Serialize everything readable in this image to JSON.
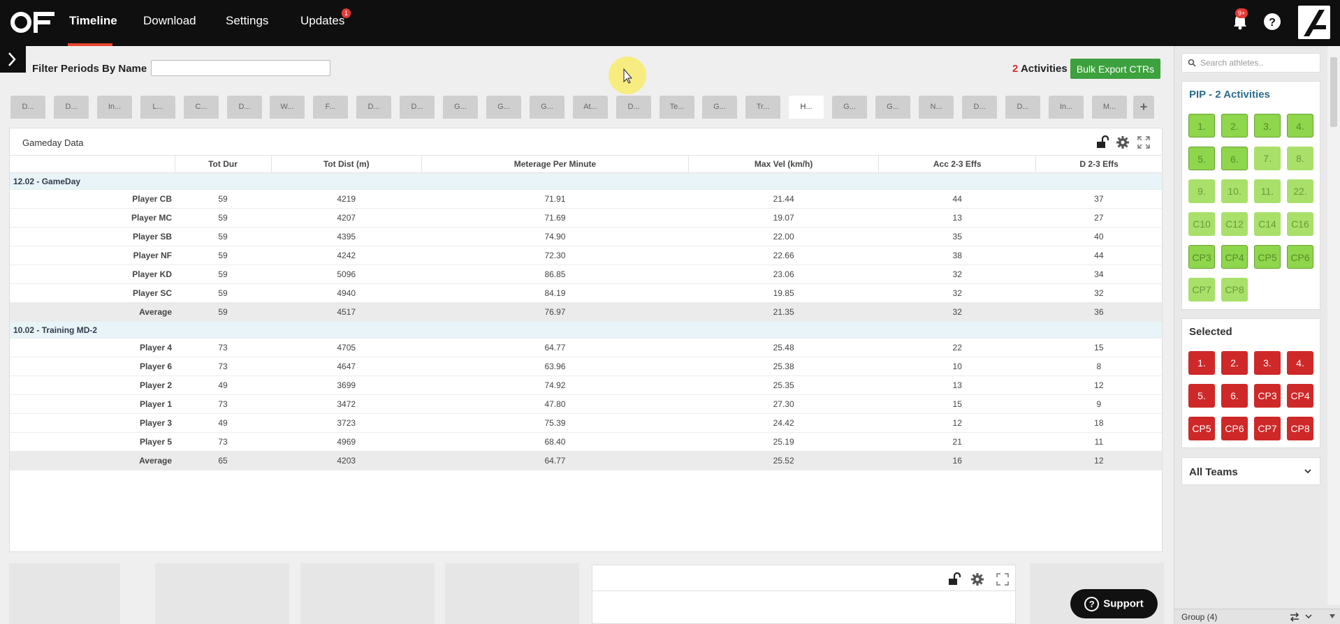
{
  "nav": {
    "items": [
      {
        "label": "Timeline",
        "active": true
      },
      {
        "label": "Download",
        "active": false
      },
      {
        "label": "Settings",
        "active": false
      },
      {
        "label": "Updates",
        "active": false,
        "badge": "1"
      }
    ],
    "notif_badge": "9+"
  },
  "filter": {
    "label": "Filter Periods By Name",
    "input_value": "",
    "activities_count": "2",
    "activities_label": "Activities",
    "export_label": "Bulk Export CTRs"
  },
  "tabs": [
    "D...",
    "D...",
    "In...",
    "L...",
    "C...",
    "D...",
    "W...",
    "F...",
    "D...",
    "D...",
    "G...",
    "G...",
    "G...",
    "At...",
    "D...",
    "Te...",
    "G...",
    "Tr...",
    "H...",
    "G...",
    "G...",
    "N...",
    "D...",
    "D...",
    "In...",
    "M..."
  ],
  "active_tab_index": 18,
  "add_tab": "+",
  "panel": {
    "title": "Gameday Data",
    "columns": [
      "",
      "Tot Dur",
      "Tot Dist (m)",
      "Meterage Per Minute",
      "Max Vel (km/h)",
      "Acc 2-3 Effs",
      "D 2-3 Effs"
    ],
    "groups": [
      {
        "name": "12.02 - GameDay",
        "rows": [
          [
            "Player CB",
            "59",
            "4219",
            "71.91",
            "21.44",
            "44",
            "37"
          ],
          [
            "Player MC",
            "59",
            "4207",
            "71.69",
            "19.07",
            "13",
            "27"
          ],
          [
            "Player SB",
            "59",
            "4395",
            "74.90",
            "22.00",
            "35",
            "40"
          ],
          [
            "Player NF",
            "59",
            "4242",
            "72.30",
            "22.66",
            "38",
            "44"
          ],
          [
            "Player KD",
            "59",
            "5096",
            "86.85",
            "23.06",
            "32",
            "34"
          ],
          [
            "Player SC",
            "59",
            "4940",
            "84.19",
            "19.85",
            "32",
            "32"
          ]
        ],
        "average": [
          "Average",
          "59",
          "4517",
          "76.97",
          "21.35",
          "32",
          "36"
        ]
      },
      {
        "name": "10.02 - Training MD-2",
        "rows": [
          [
            "Player 4",
            "73",
            "4705",
            "64.77",
            "25.48",
            "22",
            "15"
          ],
          [
            "Player 6",
            "73",
            "4647",
            "63.96",
            "25.38",
            "10",
            "8"
          ],
          [
            "Player 2",
            "49",
            "3699",
            "74.92",
            "25.35",
            "13",
            "12"
          ],
          [
            "Player 1",
            "73",
            "3472",
            "47.80",
            "27.30",
            "15",
            "9"
          ],
          [
            "Player 3",
            "49",
            "3723",
            "75.39",
            "24.42",
            "12",
            "18"
          ],
          [
            "Player 5",
            "73",
            "4969",
            "68.40",
            "25.19",
            "21",
            "11"
          ]
        ],
        "average": [
          "Average",
          "65",
          "4203",
          "64.77",
          "25.52",
          "16",
          "12"
        ]
      }
    ]
  },
  "support_label": "Support",
  "sidebar": {
    "search_placeholder": "Search athletes..",
    "pip_title": "PIP - 2 Activities",
    "pip_chips": [
      "1.",
      "2.",
      "3.",
      "4.",
      "5.",
      "6.",
      "7.",
      "8.",
      "9.",
      "10.",
      "11.",
      "22.",
      "C10",
      "C12",
      "C14",
      "C16",
      "CP3",
      "CP4",
      "CP5",
      "CP6",
      "CP7",
      "CP8"
    ],
    "selected_title": "Selected",
    "selected_chips": [
      "1.",
      "2.",
      "3.",
      "4.",
      "5.",
      "6.",
      "CP3",
      "CP4",
      "CP5",
      "CP6",
      "CP7",
      "CP8"
    ],
    "teams_label": "All Teams",
    "group_label": "Group (4)"
  }
}
